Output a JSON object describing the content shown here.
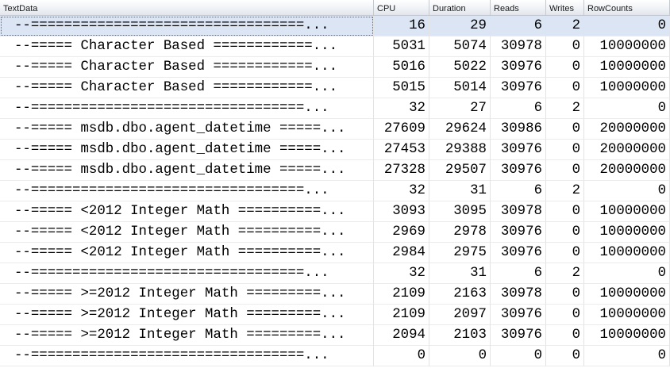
{
  "columns": [
    "TextData",
    "CPU",
    "Duration",
    "Reads",
    "Writes",
    "RowCounts"
  ],
  "rows": [
    [
      "--=================================...",
      "16",
      "29",
      "6",
      "2",
      "0"
    ],
    [
      "--===== Character Based ============...",
      "5031",
      "5074",
      "30978",
      "0",
      "10000000"
    ],
    [
      "--===== Character Based ============...",
      "5016",
      "5022",
      "30976",
      "0",
      "10000000"
    ],
    [
      "--===== Character Based ============...",
      "5015",
      "5014",
      "30976",
      "0",
      "10000000"
    ],
    [
      "--=================================...",
      "32",
      "27",
      "6",
      "2",
      "0"
    ],
    [
      "--===== msdb.dbo.agent_datetime =====...",
      "27609",
      "29624",
      "30986",
      "0",
      "20000000"
    ],
    [
      "--===== msdb.dbo.agent_datetime =====...",
      "27453",
      "29388",
      "30976",
      "0",
      "20000000"
    ],
    [
      "--===== msdb.dbo.agent_datetime =====...",
      "27328",
      "29507",
      "30976",
      "0",
      "20000000"
    ],
    [
      "--=================================...",
      "32",
      "31",
      "6",
      "2",
      "0"
    ],
    [
      "--===== <2012 Integer Math ==========...",
      "3093",
      "3095",
      "30978",
      "0",
      "10000000"
    ],
    [
      "--===== <2012 Integer Math ==========...",
      "2969",
      "2978",
      "30976",
      "0",
      "10000000"
    ],
    [
      "--===== <2012 Integer Math ==========...",
      "2984",
      "2975",
      "30976",
      "0",
      "10000000"
    ],
    [
      "--=================================...",
      "32",
      "31",
      "6",
      "2",
      "0"
    ],
    [
      "--===== >=2012 Integer Math =========...",
      "2109",
      "2163",
      "30978",
      "0",
      "10000000"
    ],
    [
      "--===== >=2012 Integer Math =========...",
      "2109",
      "2097",
      "30976",
      "0",
      "10000000"
    ],
    [
      "--===== >=2012 Integer Math =========...",
      "2094",
      "2103",
      "30976",
      "0",
      "10000000"
    ],
    [
      "--=================================...",
      "0",
      "0",
      "0",
      "0",
      "0"
    ]
  ],
  "selected_row": 0,
  "colors": {
    "selection": "#dbe5f3",
    "header_border": "#c5c9d0",
    "grid_line": "#e3e3e3"
  }
}
